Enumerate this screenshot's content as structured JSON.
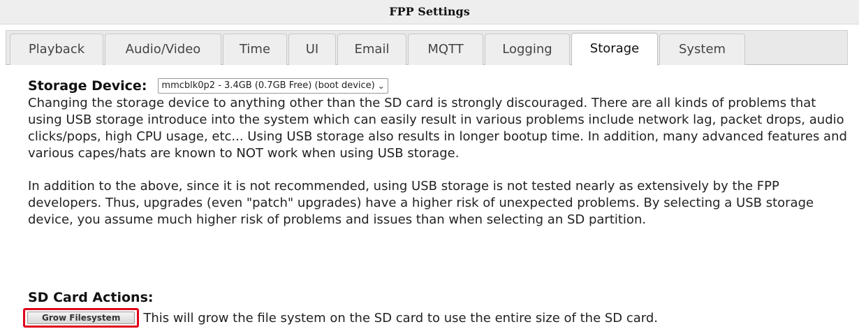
{
  "header": {
    "title": "FPP Settings"
  },
  "tabs": [
    {
      "label": "Playback"
    },
    {
      "label": "Audio/Video"
    },
    {
      "label": "Time"
    },
    {
      "label": "UI"
    },
    {
      "label": "Email"
    },
    {
      "label": "MQTT"
    },
    {
      "label": "Logging"
    },
    {
      "label": "Storage",
      "active": true
    },
    {
      "label": "System"
    }
  ],
  "storage": {
    "label": "Storage Device:",
    "selected_device": "mmcblk0p2 - 3.4GB (0.7GB Free) (boot device)",
    "warning_1": "Changing the storage device to anything other than the SD card is strongly discouraged. There are all kinds of problems that using USB storage introduce into the system which can easily result in various problems include network lag, packet drops, audio clicks/pops, high CPU usage, etc... Using USB storage also results in longer bootup time. In addition, many advanced features and various capes/hats are known to NOT work when using USB storage.",
    "warning_2": "In addition to the above, since it is not recommended, using USB storage is not tested nearly as extensively by the FPP developers. Thus, upgrades (even \"patch\" upgrades) have a higher risk of unexpected problems. By selecting a USB storage device, you assume much higher risk of problems and issues than when selecting an SD partition."
  },
  "sd_actions": {
    "label": "SD Card Actions:",
    "grow_button": "Grow Filesystem",
    "grow_description": "This will grow the file system on the SD card to use the entire size of the SD card."
  },
  "colors": {
    "highlight": "#e0001b",
    "tab_bar": "#e9e9e9"
  }
}
